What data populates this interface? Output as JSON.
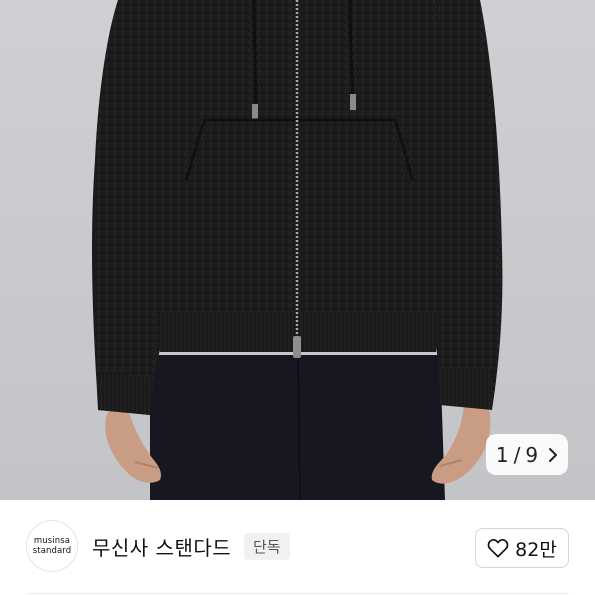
{
  "gallery": {
    "image_alt": "product-photo-black-fleece-zip-hoodie",
    "current": "1",
    "separator": "/",
    "total": "9",
    "next_icon": "chevron-right-icon"
  },
  "brand": {
    "logo_line1": "musinsa",
    "logo_line2": "standard",
    "name": "무신사 스탠다드",
    "badge": "단독"
  },
  "like": {
    "icon": "heart-outline-icon",
    "count": "82만"
  },
  "colors": {
    "background": "#c9cacd",
    "garment": "#1b1b1c",
    "text": "#111111",
    "badge_bg": "#f1f1f1"
  }
}
